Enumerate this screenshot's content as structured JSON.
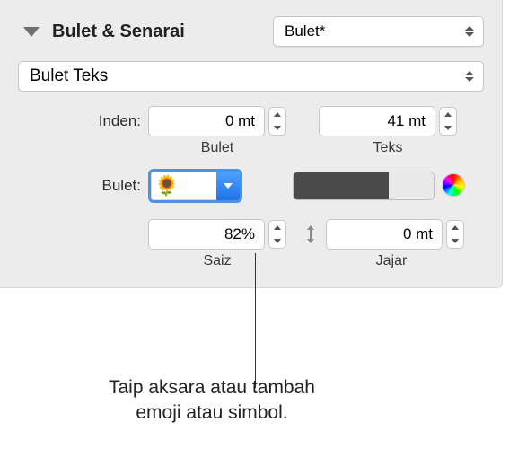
{
  "header": {
    "title": "Bulet & Senarai",
    "style_popup": "Bulet*"
  },
  "type_popup": "Bulet Teks",
  "indent": {
    "label": "Inden:",
    "bullet_value": "0 mt",
    "bullet_sublabel": "Bulet",
    "text_value": "41 mt",
    "text_sublabel": "Teks"
  },
  "bullet": {
    "label": "Bulet:",
    "emoji": "🌻"
  },
  "size": {
    "value": "82%",
    "sublabel": "Saiz"
  },
  "align": {
    "value": "0 mt",
    "sublabel": "Jajar"
  },
  "callout_line1": "Taip aksara atau tambah",
  "callout_line2": "emoji atau simbol."
}
